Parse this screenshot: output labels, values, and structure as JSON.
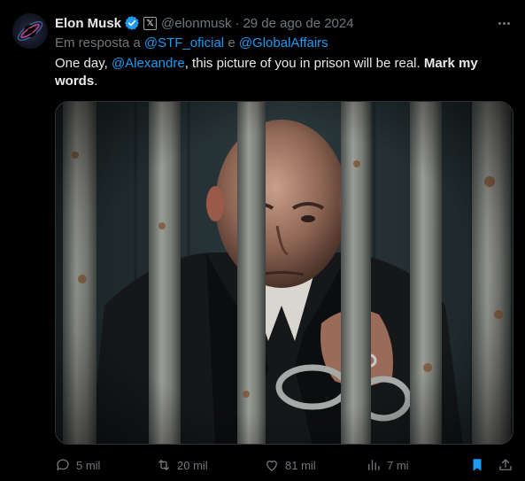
{
  "tweet": {
    "author_name": "Elon Musk",
    "author_handle": "@elonmusk",
    "separator": "·",
    "date": "29 de ago de 2024",
    "reply_prefix": "Em resposta a",
    "reply_mention_1": "@STF_oficial",
    "reply_conjunction": "e",
    "reply_mention_2": "@GlobalAffairs",
    "text_part_1": "One day, ",
    "text_mention": "@Alexandre",
    "text_part_2": ", this picture of you in prison will be real. ",
    "text_bold": "Mark my words",
    "text_end": "."
  },
  "actions": {
    "replies": "5 mil",
    "retweets": "20 mil",
    "likes": "81 mil",
    "views": "7 mi"
  },
  "colors": {
    "background": "#000000",
    "text": "#e7e9ea",
    "muted": "#71767b",
    "accent": "#1d9bf0",
    "verified": "#1d9bf0"
  },
  "icons": {
    "verified": "verified-badge-icon",
    "affiliate": "x-logo-icon",
    "more": "more-icon",
    "reply": "reply-icon",
    "retweet": "retweet-icon",
    "like": "heart-icon",
    "views": "views-chart-icon",
    "bookmark": "bookmark-icon",
    "share": "share-icon"
  }
}
